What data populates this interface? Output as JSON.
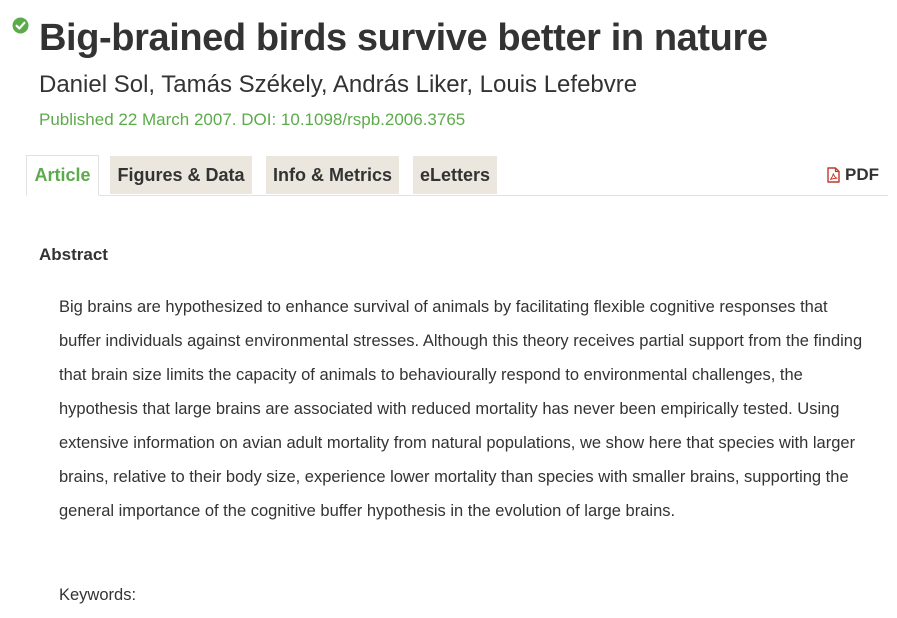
{
  "header": {
    "status_icon": "check-circle-icon",
    "title": "Big-brained birds survive better in nature",
    "authors": "Daniel Sol, Tamás Székely, András Liker, Louis Lefebvre",
    "published": "Published 22 March 2007. DOI: 10.1098/rspb.2006.3765"
  },
  "tabs": [
    {
      "label": "Article",
      "active": true
    },
    {
      "label": "Figures & Data",
      "active": false
    },
    {
      "label": "Info & Metrics",
      "active": false
    },
    {
      "label": "eLetters",
      "active": false
    }
  ],
  "pdf": {
    "icon": "pdf-file-icon",
    "label": "PDF"
  },
  "abstract": {
    "heading": "Abstract",
    "text": "Big brains are hypothesized to enhance survival of animals by facilitating flexible cognitive responses that buffer individuals against environmental stresses. Although this theory receives partial support from the finding that brain size limits the capacity of animals to behaviourally respond to environmental challenges, the hypothesis that large brains are associated with reduced mortality has never been empirically tested. Using extensive information on avian adult mortality from natural populations, we show here that species with larger brains, relative to their body size, experience lower mortality than species with smaller brains, supporting the general importance of the cognitive buffer hypothesis in the evolution of large brains."
  },
  "keywords_label": "Keywords:",
  "colors": {
    "accent_green": "#5cab4b",
    "text": "#333333",
    "tab_background": "#ebe6de",
    "pdf_icon": "#c0392b"
  }
}
